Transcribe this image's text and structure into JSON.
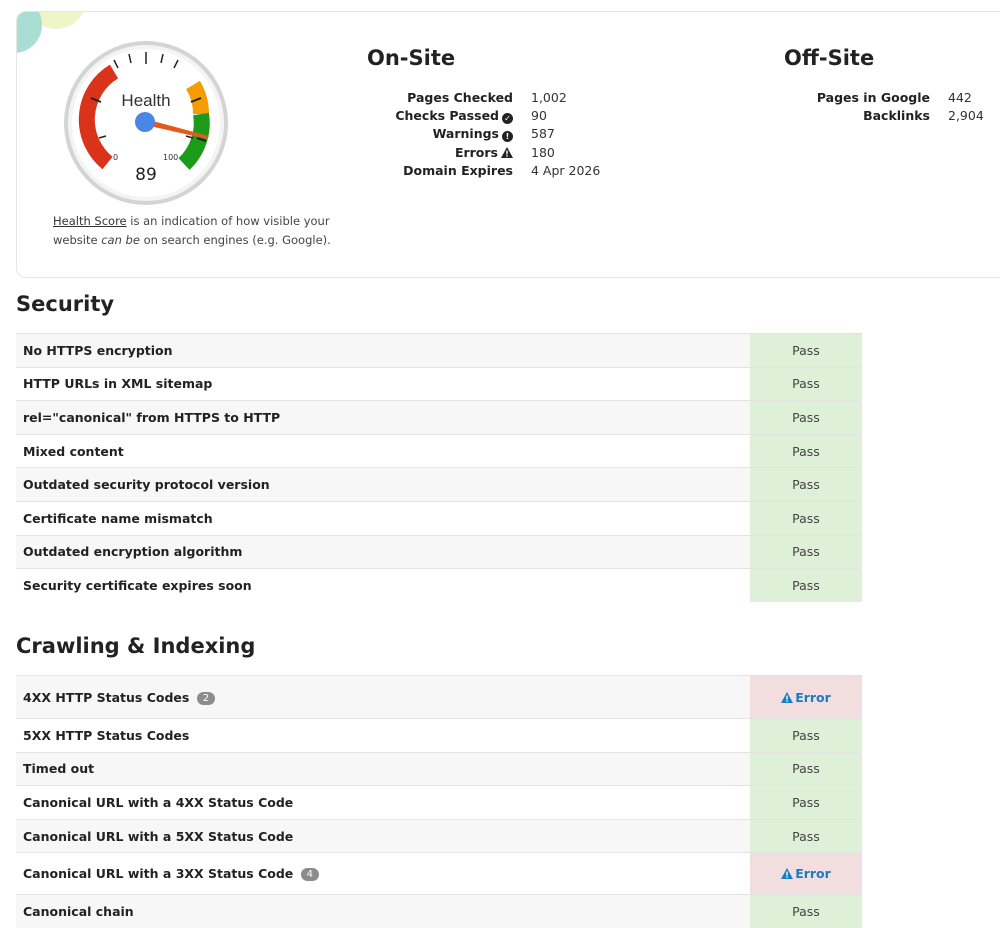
{
  "colors": {
    "pass_bg": "#dff0d8",
    "error_bg": "#f2dede",
    "error_text": "#1a7cc1",
    "gauge_red": "#d9341a",
    "gauge_orange": "#f59c00",
    "gauge_green": "#1c9a1a"
  },
  "health": {
    "label": "Health",
    "score": "89",
    "scale_min": "0",
    "scale_max": "100",
    "caption_link": "Health Score",
    "caption_text_1": " is an indication of how visible your website ",
    "caption_em": "can be",
    "caption_text_2": " on search engines (e.g. Google)."
  },
  "onsite": {
    "title": "On-Site",
    "rows": [
      {
        "label": "Pages Checked",
        "value": "1,002",
        "icon": ""
      },
      {
        "label": "Checks Passed",
        "value": "90",
        "icon": "check-circle-icon"
      },
      {
        "label": "Warnings",
        "value": "587",
        "icon": "exclamation-circle-icon"
      },
      {
        "label": "Errors",
        "value": "180",
        "icon": "warning-triangle-icon"
      },
      {
        "label": "Domain Expires",
        "value": "4 Apr 2026",
        "icon": ""
      }
    ]
  },
  "offsite": {
    "title": "Off-Site",
    "rows": [
      {
        "label": "Pages in Google",
        "value": "442"
      },
      {
        "label": "Backlinks",
        "value": "2,904"
      }
    ]
  },
  "security": {
    "title": "Security",
    "rows": [
      {
        "name": "No HTTPS encryption",
        "status": "Pass"
      },
      {
        "name": "HTTP URLs in XML sitemap",
        "status": "Pass"
      },
      {
        "name": "rel=\"canonical\" from HTTPS to HTTP",
        "status": "Pass"
      },
      {
        "name": "Mixed content",
        "status": "Pass"
      },
      {
        "name": "Outdated security protocol version",
        "status": "Pass"
      },
      {
        "name": "Certificate name mismatch",
        "status": "Pass"
      },
      {
        "name": "Outdated encryption algorithm",
        "status": "Pass"
      },
      {
        "name": "Security certificate expires soon",
        "status": "Pass"
      }
    ]
  },
  "crawling": {
    "title": "Crawling & Indexing",
    "rows": [
      {
        "name": "4XX HTTP Status Codes",
        "badge": "2",
        "status": "Error"
      },
      {
        "name": "5XX HTTP Status Codes",
        "status": "Pass"
      },
      {
        "name": "Timed out",
        "status": "Pass"
      },
      {
        "name": "Canonical URL with a 4XX Status Code",
        "status": "Pass"
      },
      {
        "name": "Canonical URL with a 5XX Status Code",
        "status": "Pass"
      },
      {
        "name": "Canonical URL with a 3XX Status Code",
        "badge": "4",
        "status": "Error"
      },
      {
        "name": "Canonical chain",
        "status": "Pass"
      }
    ]
  }
}
